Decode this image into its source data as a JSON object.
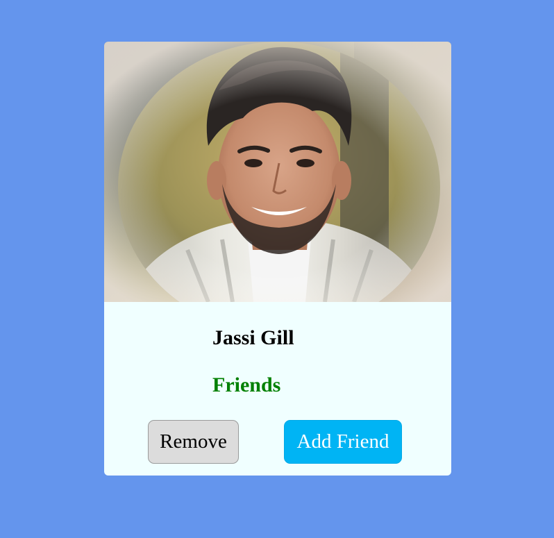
{
  "card": {
    "name": "Jassi Gill",
    "status": "Friends",
    "buttons": {
      "remove_label": "Remove",
      "add_label": "Add Friend"
    }
  },
  "colors": {
    "page_background": "#6495ED",
    "card_background": "#F0FFFF",
    "status_text": "#008000",
    "remove_button": "#DCDCDC",
    "add_button": "#00B4F4"
  }
}
